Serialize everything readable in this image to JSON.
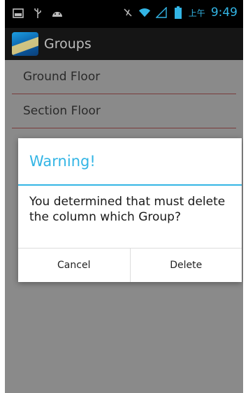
{
  "status_bar": {
    "ampm": "上午",
    "time": "9:49",
    "icons": [
      "screenshot-icon",
      "usb-icon",
      "android-debug-icon",
      "mute-icon",
      "wifi-icon",
      "signal-icon",
      "battery-icon"
    ]
  },
  "action_bar": {
    "title": "Groups"
  },
  "list": {
    "items": [
      {
        "label": "Ground Floor"
      },
      {
        "label": "Section Floor"
      }
    ]
  },
  "dialog": {
    "title": "Warning!",
    "message": "You determined that must delete the column which Group?",
    "cancel_label": "Cancel",
    "delete_label": "Delete"
  },
  "colors": {
    "accent": "#33b5e5",
    "dim_background": "#8a8a8a",
    "divider": "#7a3b3b"
  }
}
